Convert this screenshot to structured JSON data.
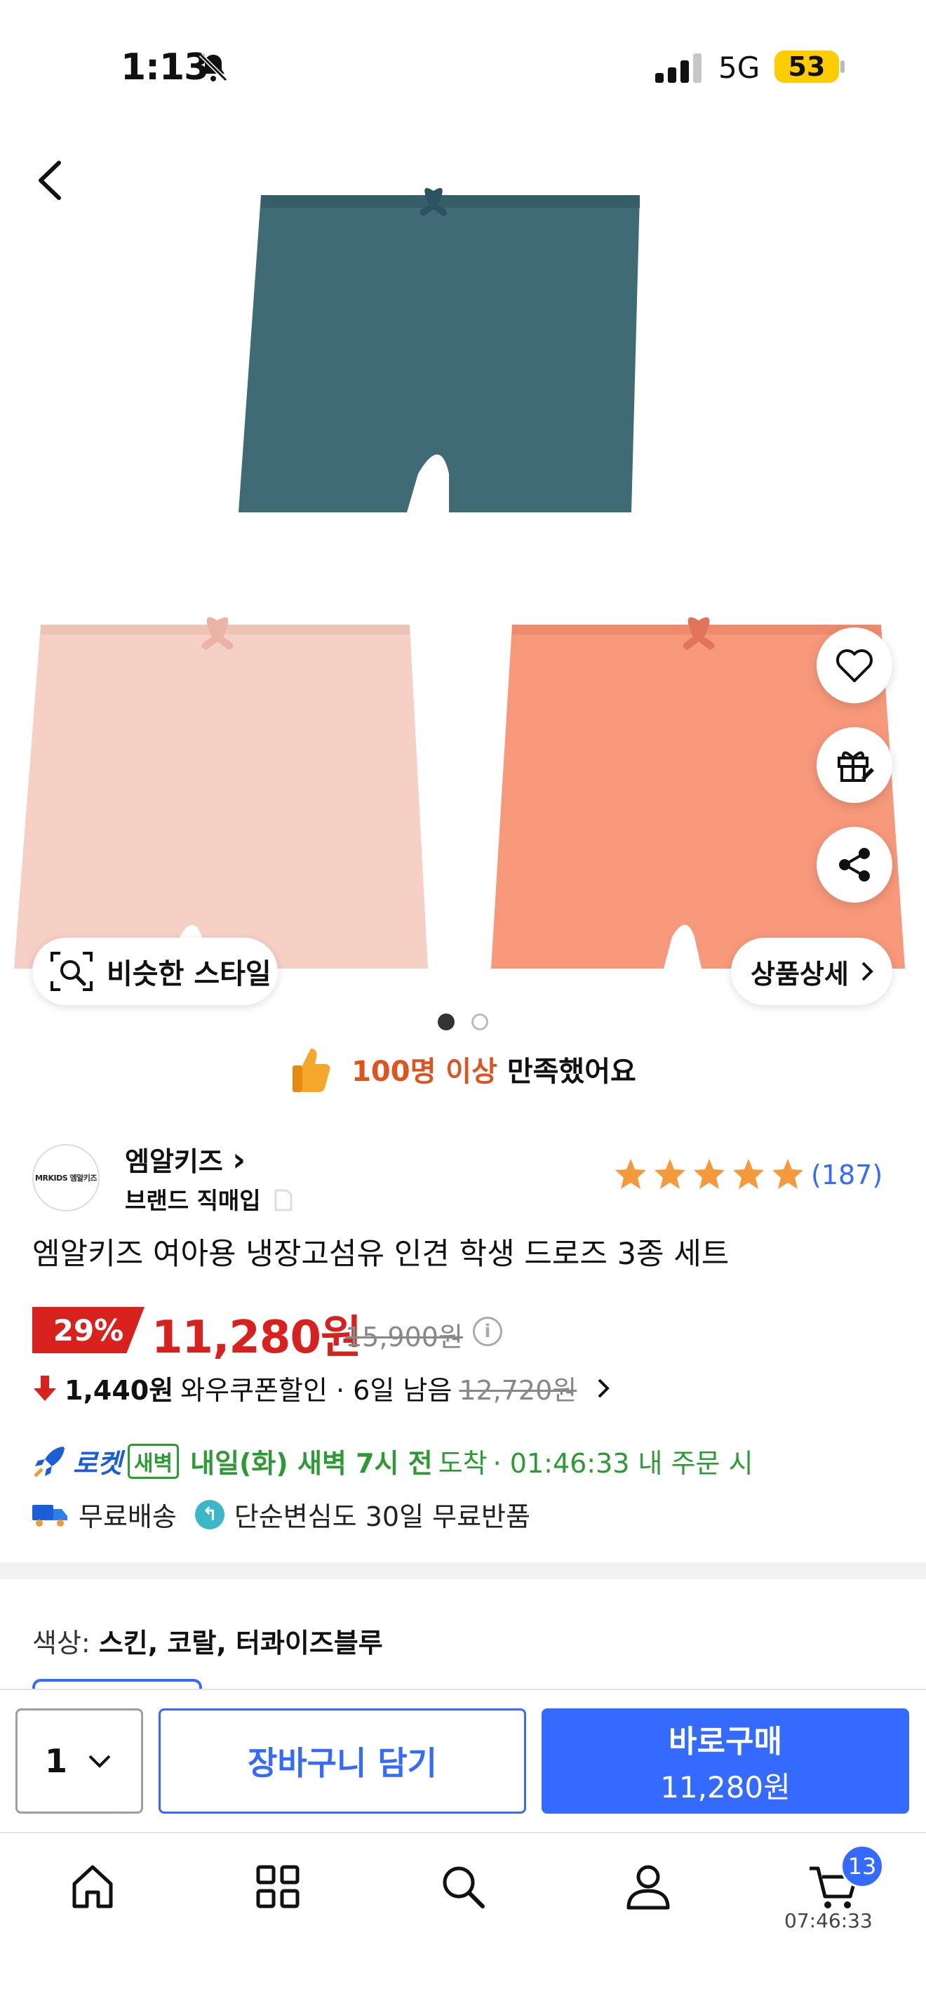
{
  "status_bar": {
    "time": "1:13",
    "network": "5G",
    "battery": "53"
  },
  "similar_style_label": "비슷한 스타일",
  "detail_label": "상품상세",
  "carousel": {
    "count": 2,
    "active": 0
  },
  "satisfaction": {
    "highlight": "100명 이상",
    "rest": " 만족했어요"
  },
  "brand": {
    "name": "엠알키즈",
    "chevron": "›",
    "sub": "브랜드 직매입",
    "logo_text": "MRKIDS 엠알키즈"
  },
  "rating": {
    "stars": 5,
    "count": "(187)"
  },
  "product_title": "엠알키즈 여아용 냉장고섬유 인견 학생 드로즈 3종 세트",
  "price": {
    "discount": "29%",
    "sale": "11,280원",
    "original": "15,900원",
    "info": "i"
  },
  "coupon": {
    "amount": "1,440원",
    "label": "와우쿠폰할인 · 6일 남음",
    "price": "12,720원"
  },
  "delivery": {
    "rocket": "로켓",
    "badge": "새벽",
    "arrival": "내일(화) 새벽 7시 전",
    "arrive_word": "도착",
    "countdown": "· 01:46:33 내 주문 시"
  },
  "shipping": {
    "free": "무료배송",
    "return": "단순변심도 30일 무료반품"
  },
  "option": {
    "label": "색상: ",
    "value": "스킨, 코랄, 터콰이즈블루"
  },
  "purchase": {
    "qty": "1",
    "cart": "장바구니 담기",
    "buy": "바로구매",
    "buy_price": "11,280원"
  },
  "tabbar": {
    "cart_badge": "13",
    "cart_time": "07:46:33"
  },
  "colors": {
    "accent": "#346aff",
    "sale_red": "#d8201c",
    "green": "#2c9b34",
    "teal": "#3f6b75",
    "skin": "#f6cfc5",
    "coral": "#f7987a"
  }
}
